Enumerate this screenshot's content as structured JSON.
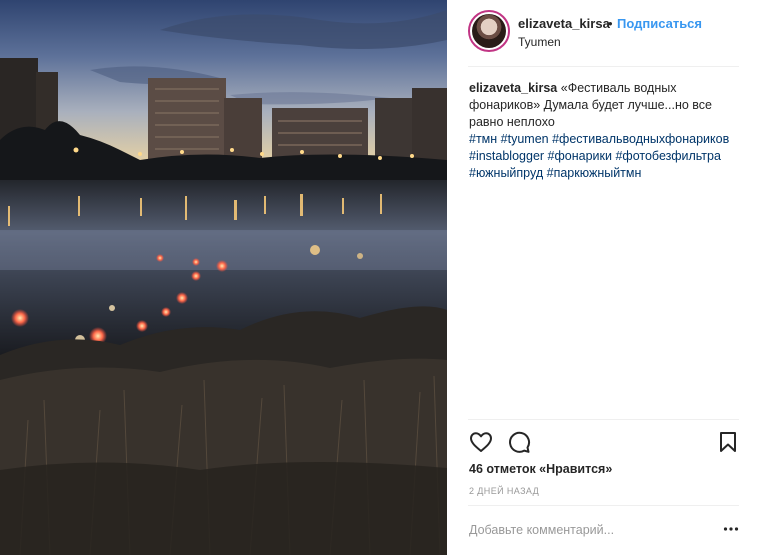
{
  "post": {
    "username": "elizaveta_kirsa",
    "separator": "•",
    "follow_label": "Подписаться",
    "location": "Tyumen",
    "caption": {
      "user": "elizaveta_kirsa",
      "text": "«Фестиваль водных фонариков» Думала будет лучше...но все равно неплохо",
      "hashtags": [
        "#тмн",
        "#tyumen",
        "#фестивальводныхфонариков",
        "#instablogger",
        "#фонарики",
        "#фотобезфильтра",
        "#южныйпруд",
        "#паркюжныйтмн"
      ]
    },
    "likes_text": "46 отметок «Нравится»",
    "time_ago": "2 ДНЕЙ НАЗАД",
    "comment_placeholder": "Добавьте комментарий..."
  },
  "icons": {
    "like": "heart-icon",
    "comment": "comment-icon",
    "save": "bookmark-icon",
    "more": "more-options-icon"
  },
  "colors": {
    "follow_link": "#3897f0",
    "hashtag": "#003569",
    "secondary_text": "#999999",
    "avatar_ring": "#c13584"
  }
}
